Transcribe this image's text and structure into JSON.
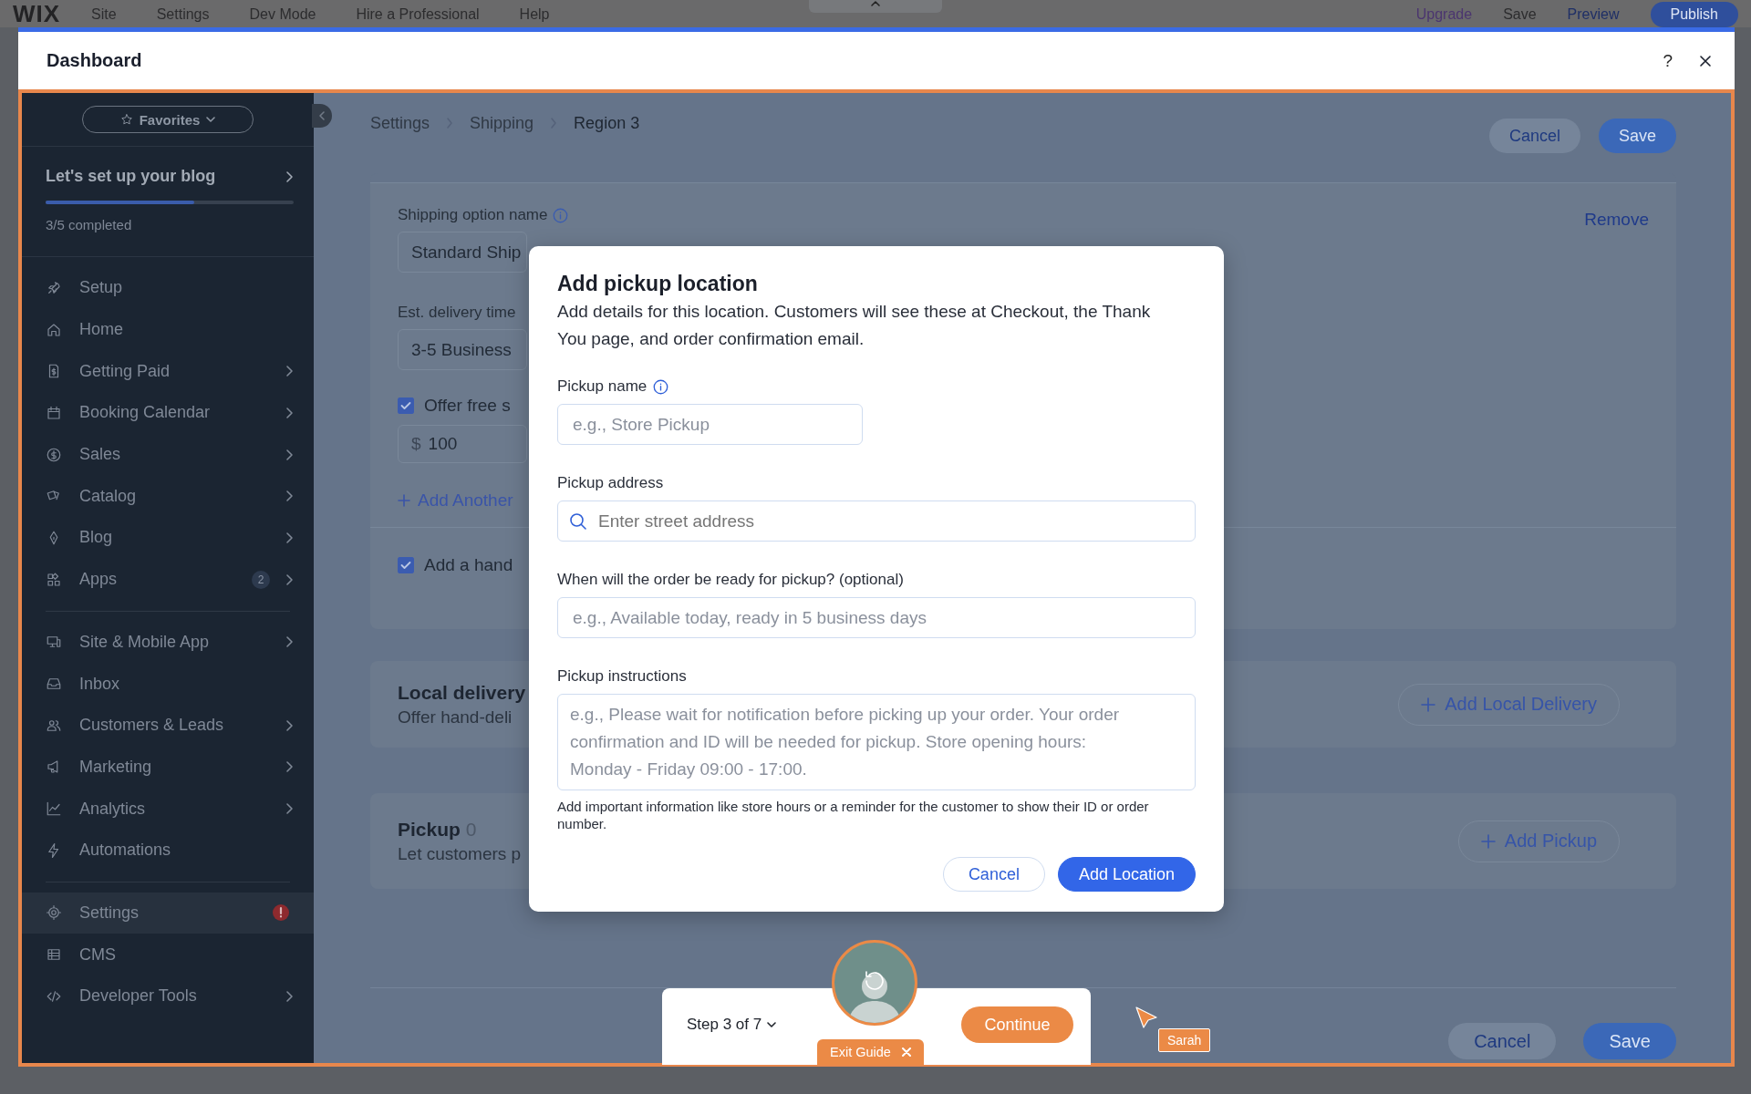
{
  "editor_bar": {
    "logo": "WIX",
    "menu": [
      "Site",
      "Settings",
      "Dev Mode",
      "Hire a Professional",
      "Help"
    ],
    "actions": [
      "Upgrade",
      "Save",
      "Preview",
      "Publish"
    ]
  },
  "window": {
    "title": "Dashboard",
    "help": "?"
  },
  "sidebar": {
    "favorites": "Favorites",
    "setup": {
      "title": "Let's set up your blog",
      "level": 0.6,
      "progress": "3/5 completed"
    },
    "groups": [
      [
        {
          "label": "Setup",
          "expandable": false,
          "alert": false,
          "selected": false
        },
        {
          "label": "Home",
          "expandable": false,
          "alert": false,
          "selected": false
        },
        {
          "label": "Getting Paid",
          "expandable": true,
          "alert": false,
          "selected": false
        },
        {
          "label": "Booking Calendar",
          "expandable": true,
          "alert": false,
          "selected": false
        },
        {
          "label": "Sales",
          "expandable": true,
          "alert": false,
          "selected": false
        },
        {
          "label": "Catalog",
          "expandable": true,
          "alert": false,
          "selected": false
        },
        {
          "label": "Blog",
          "expandable": true,
          "alert": false,
          "selected": false
        },
        {
          "label": "Apps",
          "badge": "2",
          "expandable": true,
          "alert": false,
          "selected": false
        }
      ],
      [
        {
          "label": "Site & Mobile App",
          "expandable": true,
          "alert": false,
          "selected": false
        },
        {
          "label": "Inbox",
          "expandable": false,
          "alert": false,
          "selected": false
        },
        {
          "label": "Customers & Leads",
          "expandable": true,
          "alert": false,
          "selected": false
        },
        {
          "label": "Marketing",
          "expandable": true,
          "alert": false,
          "selected": false
        },
        {
          "label": "Analytics",
          "expandable": true,
          "alert": false,
          "selected": false
        },
        {
          "label": "Automations",
          "expandable": false,
          "alert": false,
          "selected": false
        }
      ],
      [
        {
          "label": "Settings",
          "expandable": false,
          "alert": true,
          "selected": true
        },
        {
          "label": "CMS",
          "expandable": false,
          "alert": false,
          "selected": false
        },
        {
          "label": "Developer Tools",
          "expandable": true,
          "alert": false,
          "selected": false
        }
      ]
    ]
  },
  "main": {
    "breadcrumbs": [
      "Settings",
      "Shipping",
      "Region 3"
    ],
    "top_buttons": [
      {
        "label": "Cancel",
        "kind": "secondary"
      },
      {
        "label": "Save",
        "kind": "primary"
      }
    ],
    "shipping_option": {
      "name_label": "Shipping option name",
      "name_value": "Standard Ship",
      "remove": "Remove",
      "delivery_label": "Est. delivery time",
      "delivery_value": "3-5 Business",
      "free_shipping": {
        "label": "Offer free s",
        "checked": true
      },
      "min_amount": {
        "currency": "$",
        "value": "100"
      },
      "add_link": "Add Another",
      "handling_fee": {
        "label": "Add a hand",
        "checked": true
      }
    },
    "local_delivery": {
      "title": "Local delivery",
      "subtitle": "Offer hand-deli",
      "button": "Add Local Delivery"
    },
    "pickup": {
      "title": "Pickup",
      "count": "0",
      "subtitle": "Let customers p",
      "button": "Add Pickup"
    },
    "bottom_buttons": [
      {
        "label": "Cancel",
        "kind": "secondary"
      },
      {
        "label": "Save",
        "kind": "primary"
      }
    ]
  },
  "modal": {
    "title": "Add pickup location",
    "description": "Add details for this location. Customers will see these at Checkout, the Thank You page, and order confirmation email.",
    "fields": [
      {
        "kind": "short",
        "label": "Pickup name",
        "info": true,
        "placeholder": "e.g., Store Pickup"
      },
      {
        "kind": "search",
        "label": "Pickup address",
        "info": false,
        "placeholder": "Enter street address"
      },
      {
        "kind": "wide",
        "label": "When will the order be ready for pickup? (optional)",
        "info": false,
        "placeholder": "e.g., Available today, ready in 5 business days"
      },
      {
        "kind": "textarea",
        "label": "Pickup instructions",
        "info": false,
        "placeholder": "e.g., Please wait for notification before picking up your order. Your order confirmation and ID will be needed for pickup. Store opening hours: Monday - Friday 09:00 - 17:00.",
        "help": "Add important information like store hours or a reminder for the customer to show their ID or order number."
      }
    ],
    "buttons": [
      {
        "label": "Cancel",
        "kind": "secondary"
      },
      {
        "label": "Add Location",
        "kind": "primary"
      }
    ]
  },
  "guide": {
    "step": "Step 3 of 7",
    "continue": "Continue",
    "exit": "Exit Guide"
  },
  "cursor": {
    "name": "Sarah"
  }
}
